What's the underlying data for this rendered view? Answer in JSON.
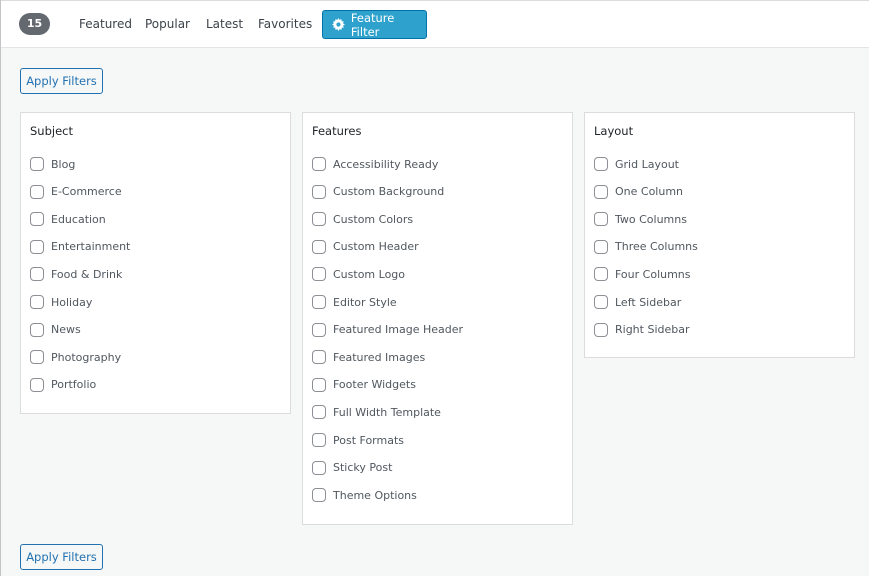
{
  "header": {
    "theme_count": "15",
    "tabs": [
      {
        "label": "Featured"
      },
      {
        "label": "Popular"
      },
      {
        "label": "Latest"
      },
      {
        "label": "Favorites"
      }
    ],
    "feature_filter": {
      "label": "Feature Filter",
      "icon": "gear-icon",
      "active": true
    }
  },
  "apply_top": {
    "label": "Apply Filters"
  },
  "apply_bottom": {
    "label": "Apply Filters"
  },
  "panels": [
    {
      "title": "Subject",
      "options": [
        "Blog",
        "E-Commerce",
        "Education",
        "Entertainment",
        "Food & Drink",
        "Holiday",
        "News",
        "Photography",
        "Portfolio"
      ]
    },
    {
      "title": "Features",
      "options": [
        "Accessibility Ready",
        "Custom Background",
        "Custom Colors",
        "Custom Header",
        "Custom Logo",
        "Editor Style",
        "Featured Image Header",
        "Featured Images",
        "Footer Widgets",
        "Full Width Template",
        "Post Formats",
        "Sticky Post",
        "Theme Options"
      ]
    },
    {
      "title": "Layout",
      "options": [
        "Grid Layout",
        "One Column",
        "Two Columns",
        "Three Columns",
        "Four Columns",
        "Left Sidebar",
        "Right Sidebar"
      ]
    }
  ],
  "colors": {
    "accent": "#2ea2cc",
    "link": "#2271b1",
    "count_badge": "#646970"
  }
}
